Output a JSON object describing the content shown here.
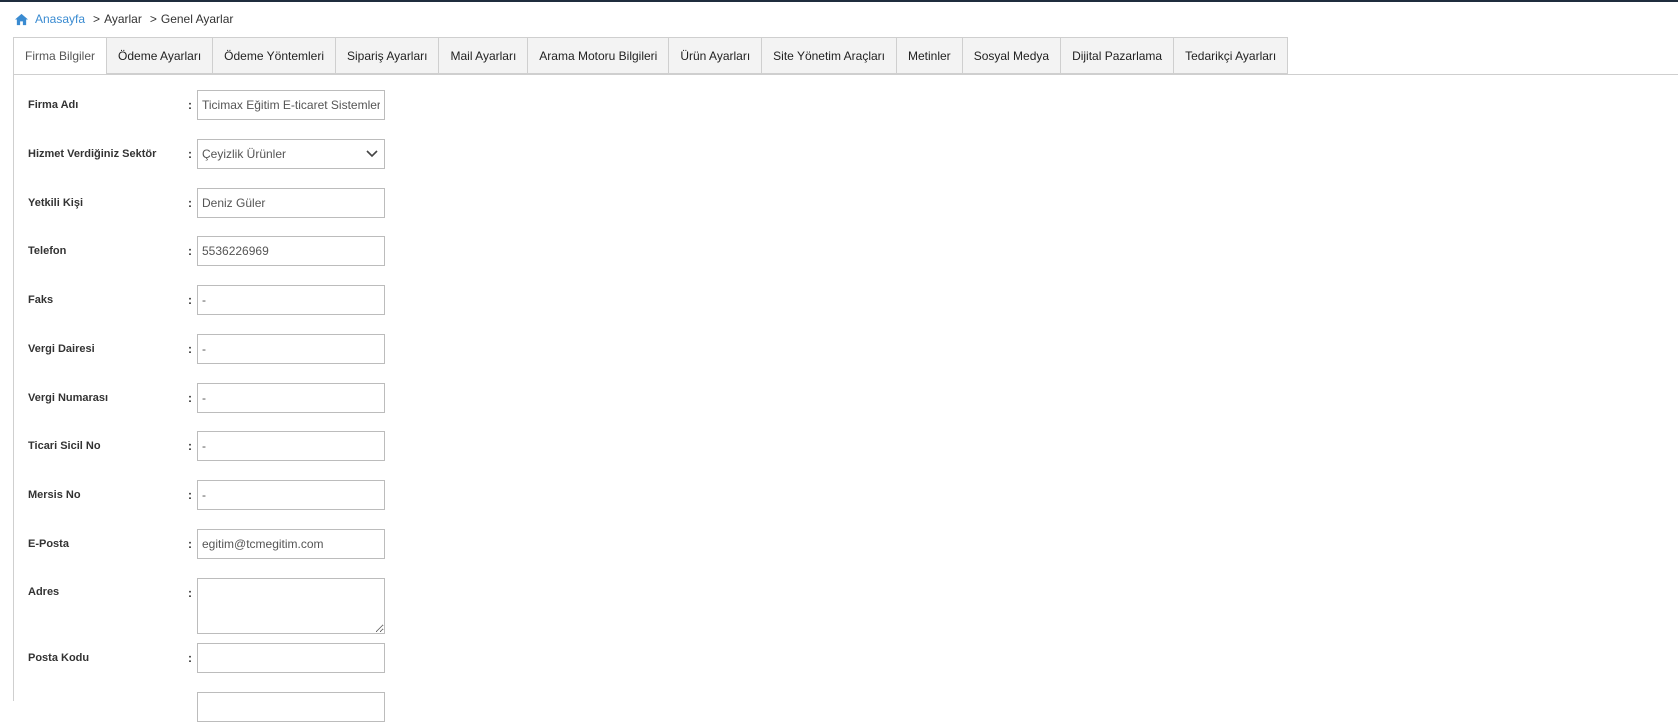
{
  "breadcrumb": {
    "home": "Anasayfa",
    "sep": ">",
    "items": [
      "Ayarlar",
      "Genel Ayarlar"
    ]
  },
  "tabs": [
    {
      "label": "Firma Bilgiler",
      "active": true
    },
    {
      "label": "Ödeme Ayarları",
      "active": false
    },
    {
      "label": "Ödeme Yöntemleri",
      "active": false
    },
    {
      "label": "Sipariş Ayarları",
      "active": false
    },
    {
      "label": "Mail Ayarları",
      "active": false
    },
    {
      "label": "Arama Motoru Bilgileri",
      "active": false
    },
    {
      "label": "Ürün Ayarları",
      "active": false
    },
    {
      "label": "Site Yönetim Araçları",
      "active": false
    },
    {
      "label": "Metinler",
      "active": false
    },
    {
      "label": "Sosyal Medya",
      "active": false
    },
    {
      "label": "Dijital Pazarlama",
      "active": false
    },
    {
      "label": "Tedarikçi Ayarları",
      "active": false
    }
  ],
  "colon": ":",
  "form": {
    "firma_adi": {
      "label": "Firma Adı",
      "value": "Ticimax Eğitim E-ticaret Sistemleri"
    },
    "sektor": {
      "label": "Hizmet Verdiğiniz Sektör",
      "value": "Çeyizlik Ürünler"
    },
    "yetkili": {
      "label": "Yetkili Kişi",
      "value": "Deniz Güler"
    },
    "telefon": {
      "label": "Telefon",
      "value": "5536226969"
    },
    "faks": {
      "label": "Faks",
      "value": "-"
    },
    "vergi_dairesi": {
      "label": "Vergi Dairesi",
      "value": "-"
    },
    "vergi_numarasi": {
      "label": "Vergi Numarası",
      "value": "-"
    },
    "ticari_sicil": {
      "label": "Ticari Sicil No",
      "value": "-"
    },
    "mersis": {
      "label": "Mersis No",
      "value": "-"
    },
    "eposta": {
      "label": "E-Posta",
      "value": "egitim@tcmegitim.com"
    },
    "adres": {
      "label": "Adres",
      "value": ""
    },
    "posta_kodu": {
      "label": "Posta Kodu",
      "value": ""
    }
  },
  "colors": {
    "link": "#3a8bd1",
    "topbar": "#1f2d3d",
    "border": "#cfcfcf"
  }
}
